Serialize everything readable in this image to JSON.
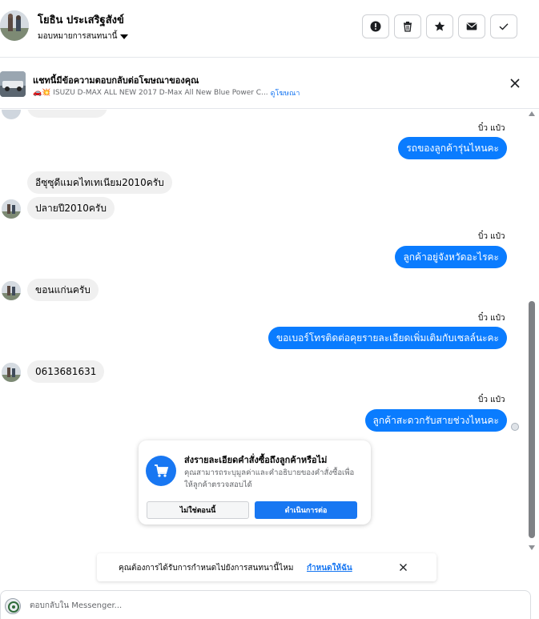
{
  "header": {
    "contact_name": "โยธิน ประเสริฐสังข์",
    "assign_label": "มอบหมายการสนทนานี้",
    "actions": [
      {
        "name": "alert-icon",
        "label": "!"
      },
      {
        "name": "trash-icon",
        "label": "delete"
      },
      {
        "name": "star-icon",
        "label": "star"
      },
      {
        "name": "mail-icon",
        "label": "mail"
      },
      {
        "name": "check-icon",
        "label": "done"
      }
    ]
  },
  "ad": {
    "title": "แชทนี้มีข้อความตอบกลับต่อโฆษณาของคุณ",
    "subtitle": "🚗💥 ISUZU D-MAX ALL NEW 2017 D-Max All New Blue Power C...",
    "link": "ดูโฆษณา"
  },
  "messages": [
    {
      "dir": "out",
      "sender": "บิ๋ว แป๋ว",
      "text": "รถของลูกค้ารุ่นไหนคะ"
    },
    {
      "dir": "in",
      "text": "อีซุซุดีแมคไทเทเนียม2010ครับ"
    },
    {
      "dir": "in",
      "text": "ปลายปี2010ครับ"
    },
    {
      "dir": "out",
      "sender": "บิ๋ว แป๋ว",
      "text": "ลูกค้าอยู่จังหวัดอะไรคะ"
    },
    {
      "dir": "in",
      "text": "ขอนแก่นครับ"
    },
    {
      "dir": "out",
      "sender": "บิ๋ว แป๋ว",
      "text": "ขอเบอร์โทรติดต่อคุยรายละเอียดเพิ่มเติมกับเซลล์นะคะ"
    },
    {
      "dir": "in",
      "text": "0613681631"
    },
    {
      "dir": "out",
      "sender": "บิ๋ว แป๋ว",
      "text": "ลูกค้าสะดวกรับสายช่วงไหนคะ"
    }
  ],
  "order_card": {
    "title": "ส่งรายละเอียดคำสั่งซื้อถึงลูกค้าหรือไม่",
    "description": "คุณสามารถระบุมูลค่าและคำอธิบายของคำสั่งซื้อเพื่อให้ลูกค้าตรวจสอบได้",
    "decline_label": "ไม่ใช่ตอนนี้",
    "accept_label": "ดำเนินการต่อ",
    "accent_color": "#1877f2"
  },
  "assign_banner": {
    "text": "คุณต้องการได้รับการกำหนดไปยังการสนทนานี้ไหม",
    "link": "กำหนดให้ฉัน"
  },
  "composer": {
    "placeholder": "ตอบกลับใน Messenger..."
  },
  "colors": {
    "outgoing_bubble": "#0a7cff",
    "incoming_bubble": "#f0f0f0"
  }
}
